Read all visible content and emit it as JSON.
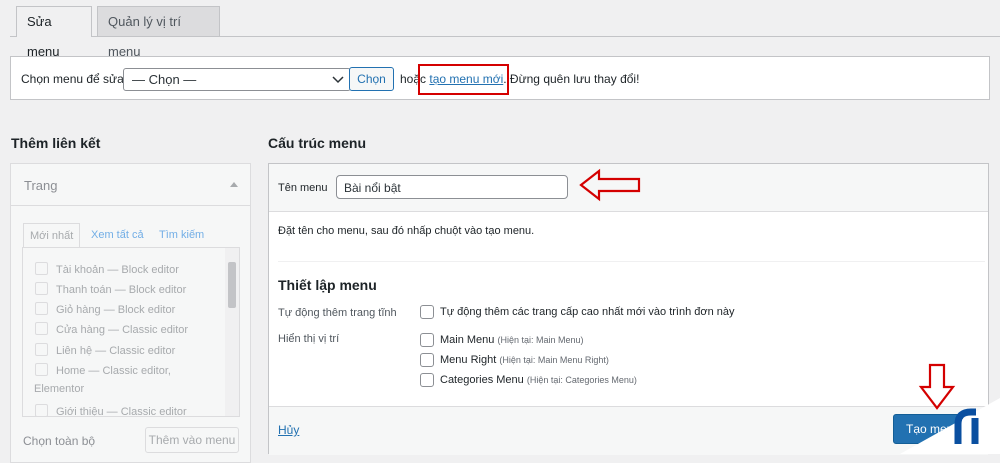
{
  "tabs": [
    {
      "label": "Sửa menu",
      "active": true
    },
    {
      "label": "Quản lý vị trí menu",
      "active": false
    }
  ],
  "select_menu": {
    "label": "Chọn menu để sửa:",
    "value": "— Chọn —",
    "button": "Chọn",
    "text_before": "hoặc ",
    "create_link": "tạo menu mới",
    "text_after": ". Đừng quên lưu thay đổi!"
  },
  "left": {
    "heading": "Thêm liên kết",
    "section_title": "Trang",
    "tabs": [
      "Mới nhất",
      "Xem tất cả",
      "Tìm kiếm"
    ],
    "items": [
      {
        "name": "Tài khoản",
        "suffix": " — Block editor"
      },
      {
        "name": "Thanh toán",
        "suffix": " — Block editor"
      },
      {
        "name": "Giỏ hàng",
        "suffix": " — Block editor"
      },
      {
        "name": "Cửa hàng",
        "suffix": " — Classic editor"
      },
      {
        "name": "Liên hệ",
        "suffix": " — Classic editor"
      },
      {
        "name": "Home",
        "suffix": " — Classic editor,"
      },
      {
        "name": "Elementor",
        "suffix": ""
      },
      {
        "name": "Giới thiệu",
        "suffix": " — Classic editor"
      }
    ],
    "select_all": "Chọn toàn bộ",
    "add_button": "Thêm vào menu"
  },
  "right": {
    "heading": "Cấu trúc menu",
    "name_label": "Tên menu",
    "name_value": "Bài nổi bật",
    "instruction": "Đặt tên cho menu, sau đó nhấp chuột vào tạo menu.",
    "settings_title": "Thiết lập menu",
    "auto_add_label": "Tự động thêm trang tĩnh",
    "auto_add_option": "Tự động thêm các trang cấp cao nhất mới vào trình đơn này",
    "display_label": "Hiển thị vị trí",
    "locations": [
      {
        "name": "Main Menu",
        "current": "(Hiện tại: Main Menu)"
      },
      {
        "name": "Menu Right",
        "current": "(Hiện tại: Main Menu Right)"
      },
      {
        "name": "Categories Menu",
        "current": "(Hiện tại: Categories Menu)"
      }
    ],
    "cancel": "Hủy",
    "create_button": "Tạo menu"
  },
  "colors": {
    "accent": "#2271b1",
    "annotation": "#d40000",
    "logo": "#0a4fa0"
  },
  "icons": [
    "chevron-down-icon",
    "collapse-arrow-icon",
    "red-left-arrow-icon",
    "red-down-arrow-icon",
    "brand-logo-icon"
  ]
}
